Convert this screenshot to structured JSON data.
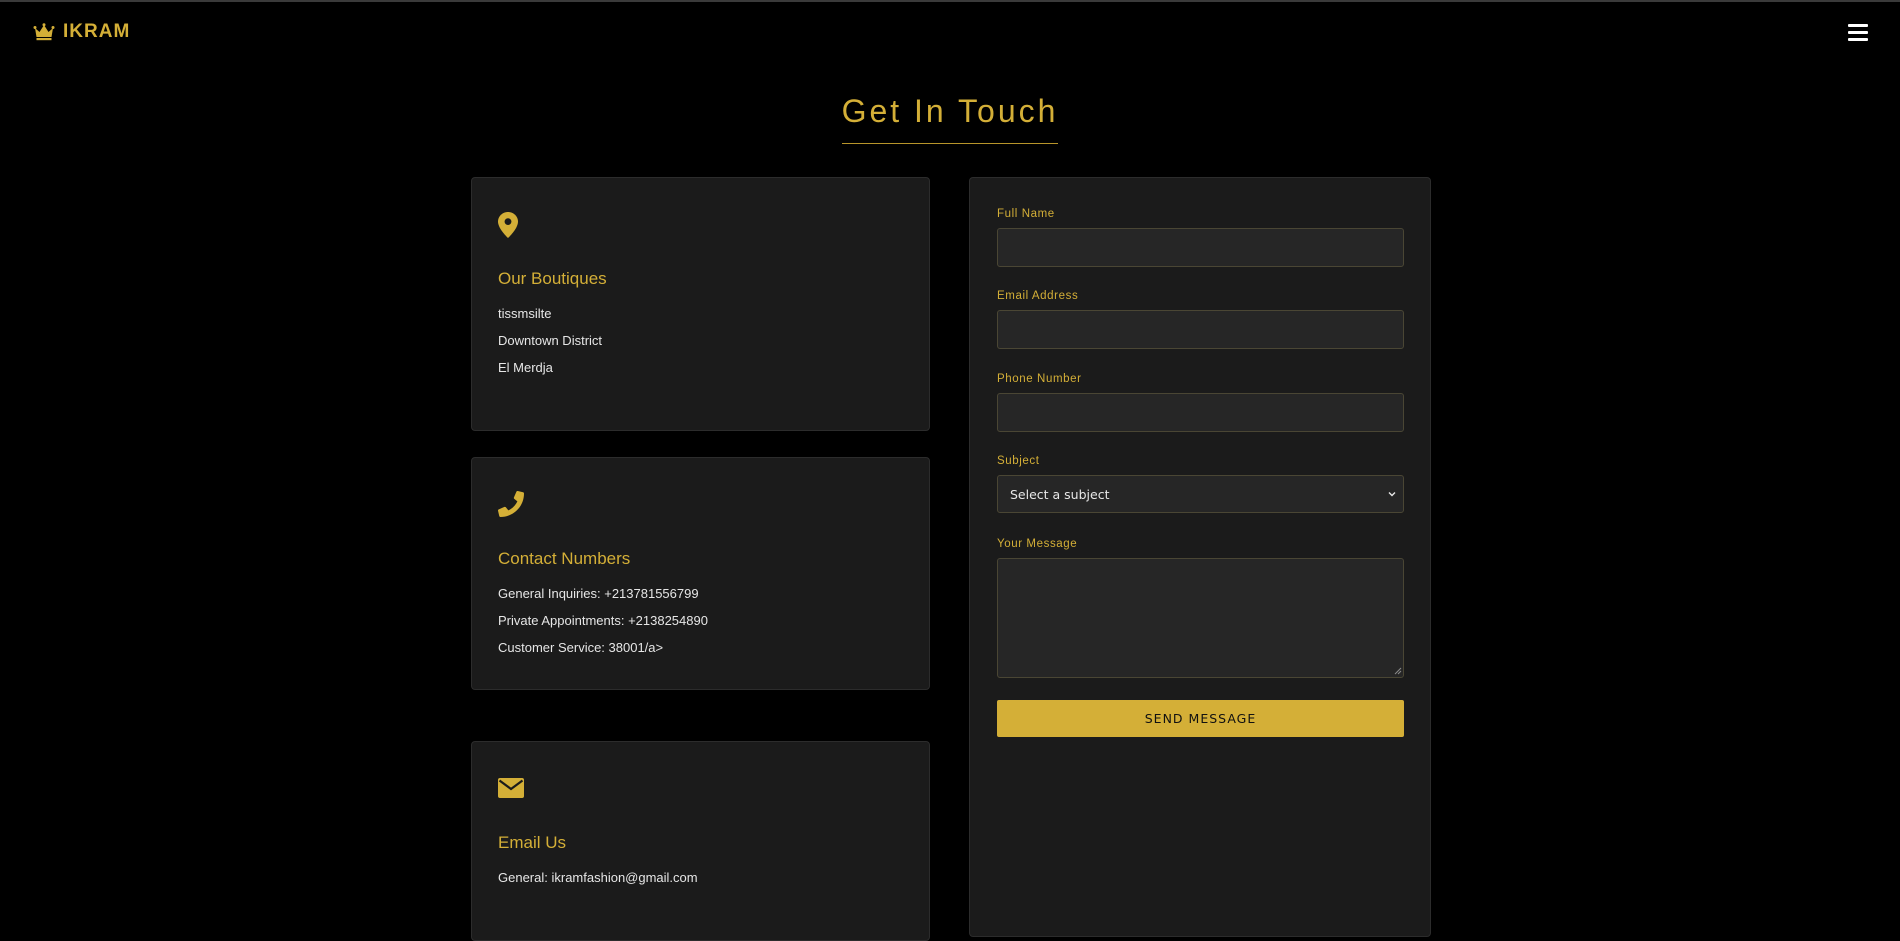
{
  "colors": {
    "accent": "#d4af37",
    "background": "#000000",
    "card": "#1b1b1b",
    "input": "#262626",
    "text": "#e6e6e6"
  },
  "header": {
    "brand_name": "IKRAM",
    "logo_icon": "crown-icon",
    "menu_icon": "hamburger-menu-icon"
  },
  "page": {
    "title": "Get In Touch"
  },
  "cards": {
    "boutiques": {
      "icon": "map-pin-icon",
      "title": "Our Boutiques",
      "lines": [
        "tissmsilte",
        "Downtown District",
        "El Merdja"
      ]
    },
    "phones": {
      "icon": "phone-icon",
      "title": "Contact Numbers",
      "lines": [
        "General Inquiries: +213781556799",
        "Private Appointments: +2138254890",
        "Customer Service: 38001/a>"
      ]
    },
    "email": {
      "icon": "envelope-icon",
      "title": "Email Us",
      "lines": [
        "General: ikramfashion@gmail.com"
      ]
    }
  },
  "form": {
    "full_name": {
      "label": "Full Name",
      "value": "",
      "placeholder": ""
    },
    "email": {
      "label": "Email Address",
      "value": "",
      "placeholder": ""
    },
    "phone": {
      "label": "Phone Number",
      "value": "",
      "placeholder": ""
    },
    "subject": {
      "label": "Subject",
      "selected": "Select a subject"
    },
    "message": {
      "label": "Your Message",
      "value": "",
      "placeholder": ""
    },
    "submit_label": "SEND MESSAGE"
  }
}
